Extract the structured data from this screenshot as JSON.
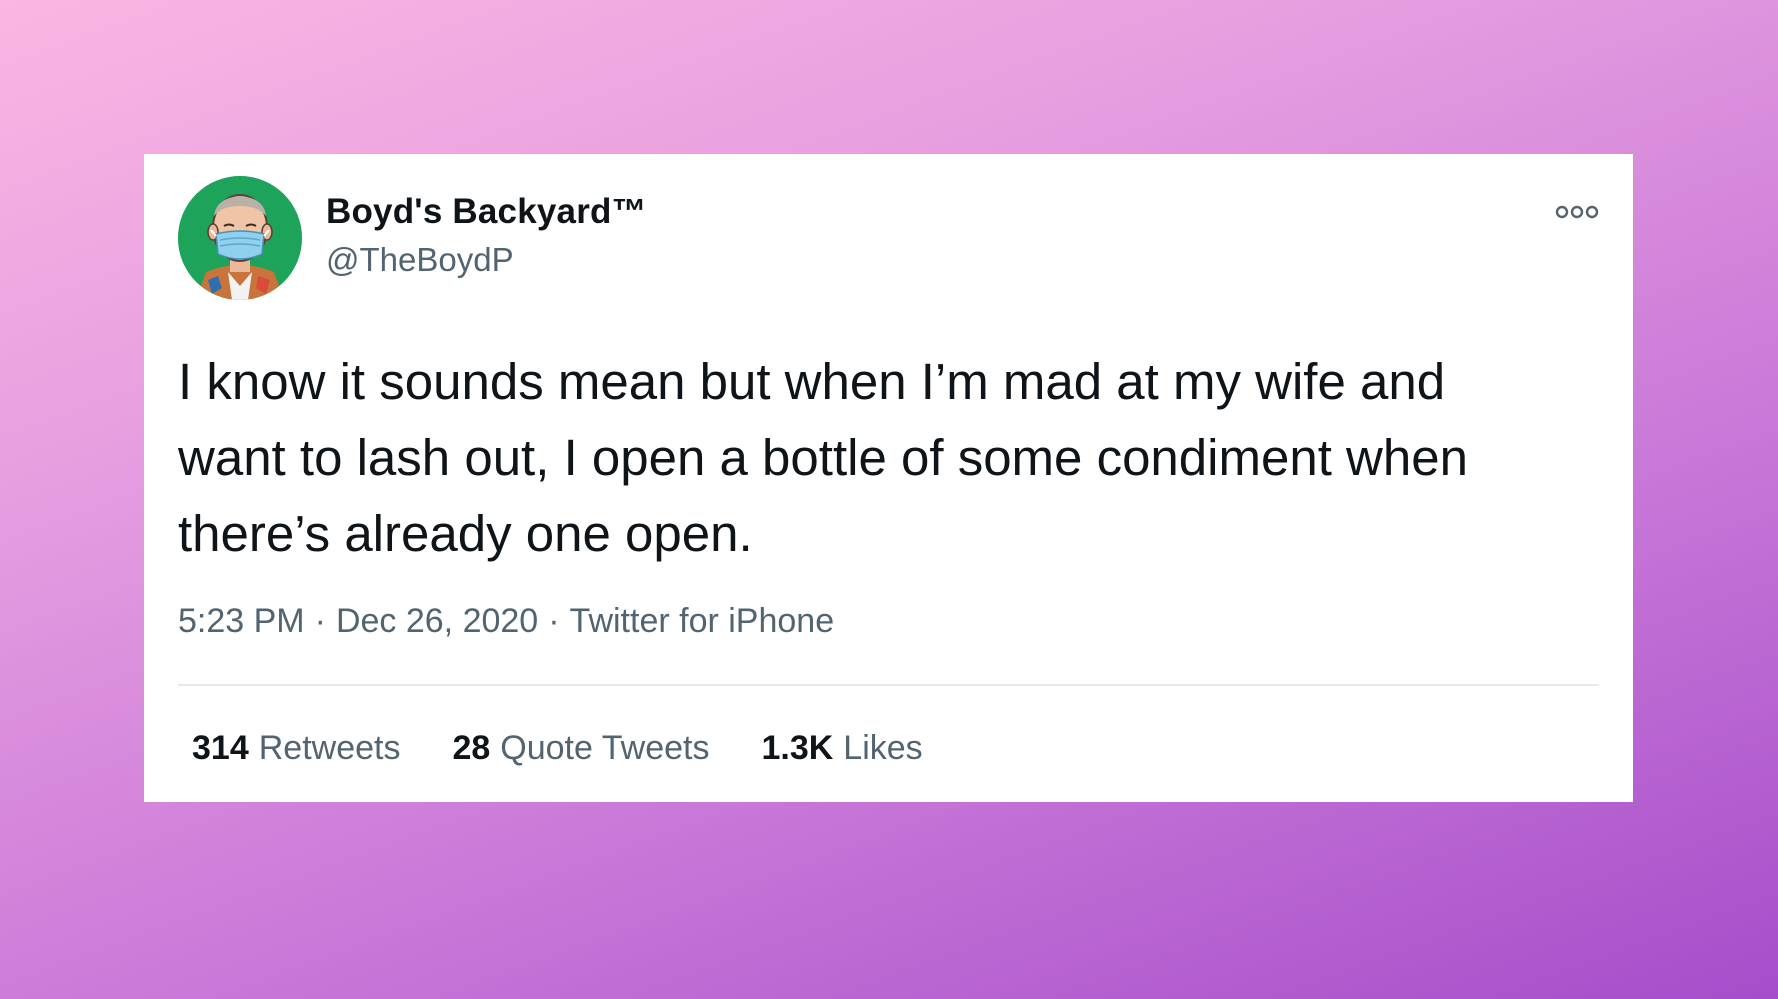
{
  "tweet": {
    "display_name": "Boyd's Backyard™",
    "handle": "@TheBoydP",
    "text": "I know it sounds mean but when I’m mad at my wife and\nwant to lash out, I open a bottle of some condiment when\nthere’s already one open.",
    "time": "5:23 PM",
    "date": "Dec 26, 2020",
    "source": "Twitter for iPhone",
    "separator": "·",
    "more_icon": "more-horizontal-icon",
    "avatar_icon": "avatar-masked-man"
  },
  "stats": {
    "retweets_count": "314",
    "retweets_label": "Retweets",
    "quotes_count": "28",
    "quotes_label": "Quote Tweets",
    "likes_count": "1.3K",
    "likes_label": "Likes"
  },
  "colors": {
    "background_start": "#fbb6e2",
    "background_end": "#a64dca",
    "card": "#ffffff",
    "text_primary": "#0f1419",
    "text_secondary": "#536471",
    "avatar_bg": "#1ea35a"
  }
}
